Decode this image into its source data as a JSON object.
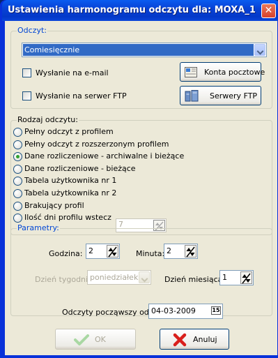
{
  "window": {
    "title": "Ustawienia harmonogramu odczytu dla: MOXA_1",
    "close_glyph": "✕"
  },
  "odczyt": {
    "legend": "Odczyt:",
    "frequency_selected": "Comiesięcznie",
    "email_label": "Wysłanie na e-mail",
    "ftp_label": "Wysłanie na serwer FTP",
    "email_checked": false,
    "ftp_checked": false,
    "mail_accounts_button": "Konta pocztowe",
    "ftp_servers_button": "Serwery FTP"
  },
  "rodzaj": {
    "legend": "Rodzaj odczytu:",
    "options": [
      {
        "label": "Pełny odczyt z profilem",
        "selected": false
      },
      {
        "label": "Pełny odczyt z rozszerzonym profilem",
        "selected": false
      },
      {
        "label": "Dane rozliczeniowe - archiwalne i bieżące",
        "selected": true
      },
      {
        "label": "Dane rozliczeniowe - bieżące",
        "selected": false
      },
      {
        "label": "Tabela użytkownika nr 1",
        "selected": false
      },
      {
        "label": "Tabela użytkownika nr 2",
        "selected": false
      },
      {
        "label": "Brakujący profil",
        "selected": false
      },
      {
        "label": "Ilość dni profilu wstecz",
        "selected": false
      }
    ],
    "profile_days_value": "7"
  },
  "parametry": {
    "legend": "Parametry:",
    "hour_label": "Godzina:",
    "hour_value": "2",
    "minute_label": "Minuta:",
    "minute_value": "2",
    "weekday_label": "Dzień tygodnia:",
    "weekday_value": "poniedziałek",
    "monthday_label": "Dzień miesiąca:",
    "monthday_value": "1",
    "start_label": "Odczyty począwszy od:",
    "start_date": "04-03-2009",
    "calendar_glyph": "15"
  },
  "footer": {
    "ok_label": "OK",
    "cancel_label": "Anuluj"
  },
  "colors": {
    "accent_blue": "#0046d5",
    "selection": "#316ac5",
    "ok_check": "#4caf50",
    "cancel_x": "#d9201c"
  }
}
